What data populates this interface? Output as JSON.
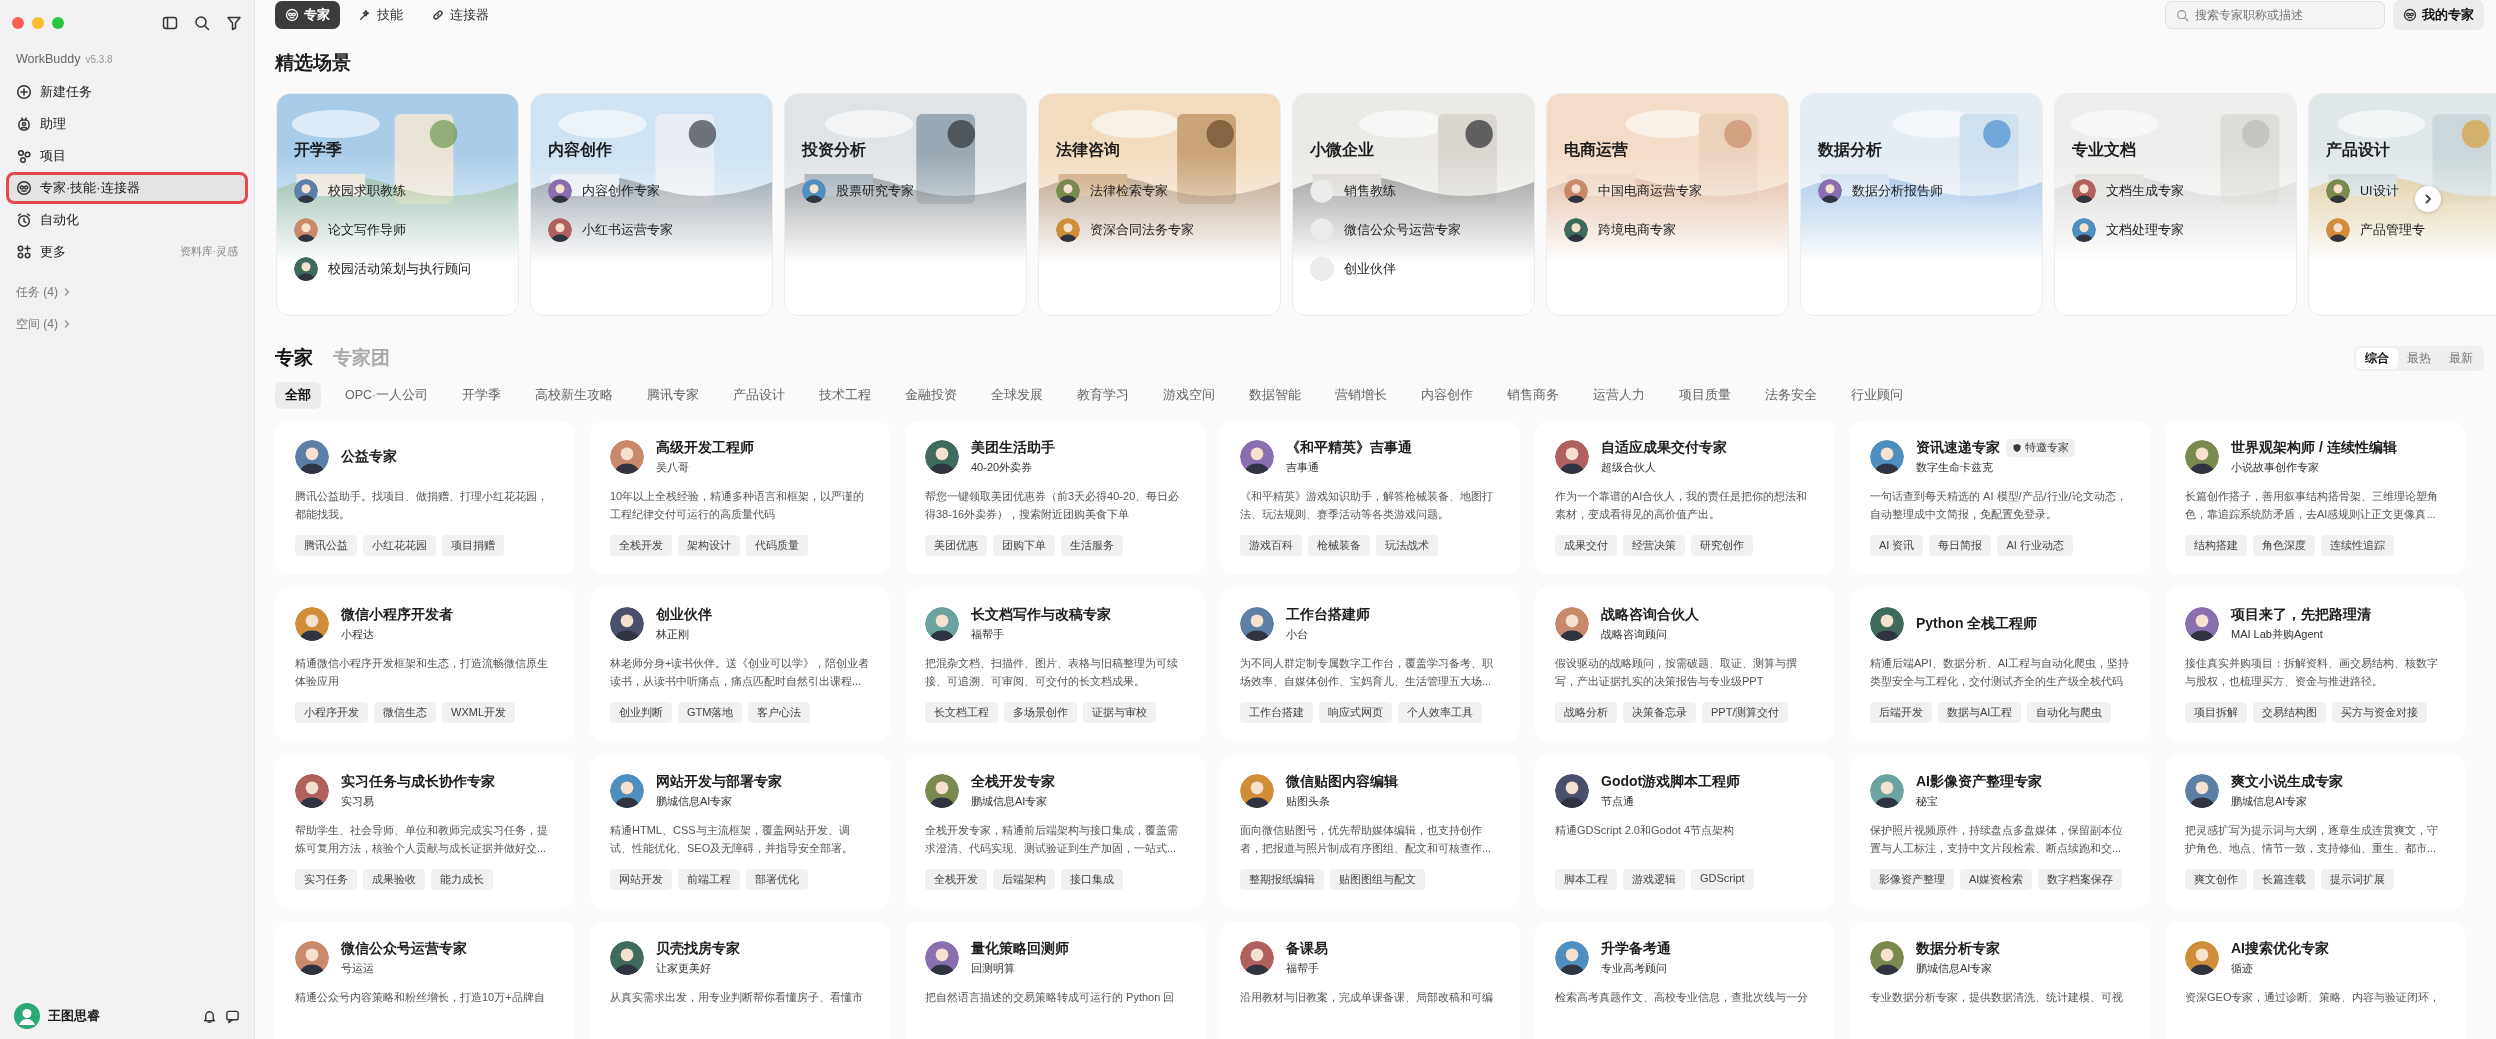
{
  "sidebar": {
    "app_name": "WorkBuddy",
    "version": "v5.3.8",
    "nav": [
      {
        "label": "新建任务",
        "selected": false
      },
      {
        "label": "助理",
        "selected": false
      },
      {
        "label": "项目",
        "selected": false
      },
      {
        "label": "专家·技能·连接器",
        "selected": true
      },
      {
        "label": "自动化",
        "selected": false
      },
      {
        "label": "更多",
        "selected": false,
        "note": "资料库·灵感"
      }
    ],
    "groups": [
      {
        "label": "任务 (4)"
      },
      {
        "label": "空间 (4)"
      }
    ],
    "user": {
      "name": "王图思睿"
    }
  },
  "top_tabs": [
    {
      "label": "专家",
      "selected": true
    },
    {
      "label": "技能",
      "selected": false
    },
    {
      "label": "连接器",
      "selected": false
    }
  ],
  "search": {
    "placeholder": "搜索专家职称或描述"
  },
  "my_experts_button": "我的专家",
  "featured": {
    "title": "精选场景",
    "scenes": [
      {
        "title": "开学季",
        "experts": [
          {
            "name": "校园求职教练",
            "avatar": true
          },
          {
            "name": "论文写作导师",
            "avatar": true
          },
          {
            "name": "校园活动策划与执行顾问",
            "avatar": true
          }
        ]
      },
      {
        "title": "内容创作",
        "experts": [
          {
            "name": "内容创作专家",
            "avatar": true
          },
          {
            "name": "小红书运营专家",
            "avatar": true
          }
        ]
      },
      {
        "title": "投资分析",
        "experts": [
          {
            "name": "股票研究专家",
            "avatar": true
          }
        ]
      },
      {
        "title": "法律咨询",
        "experts": [
          {
            "name": "法律检索专家",
            "avatar": true
          },
          {
            "name": "资深合同法务专家",
            "avatar": true
          }
        ]
      },
      {
        "title": "小微企业",
        "experts": [
          {
            "name": "销售教练",
            "avatar": false
          },
          {
            "name": "微信公众号运营专家",
            "avatar": false
          },
          {
            "name": "创业伙伴",
            "avatar": false
          }
        ]
      },
      {
        "title": "电商运营",
        "experts": [
          {
            "name": "中国电商运营专家",
            "avatar": true
          },
          {
            "name": "跨境电商专家",
            "avatar": true
          }
        ]
      },
      {
        "title": "数据分析",
        "experts": [
          {
            "name": "数据分析报告师",
            "avatar": true
          }
        ]
      },
      {
        "title": "专业文档",
        "experts": [
          {
            "name": "文档生成专家",
            "avatar": true
          },
          {
            "name": "文档处理专家",
            "avatar": true
          }
        ]
      },
      {
        "title": "产品设计",
        "experts": [
          {
            "name": "UI设计",
            "avatar": true
          },
          {
            "name": "产品管理专",
            "avatar": true
          }
        ]
      }
    ]
  },
  "experts": {
    "tabs": [
      {
        "label": "专家",
        "selected": true
      },
      {
        "label": "专家团",
        "selected": false
      }
    ],
    "sort": [
      {
        "label": "综合",
        "selected": true
      },
      {
        "label": "最热",
        "selected": false
      },
      {
        "label": "最新",
        "selected": false
      }
    ],
    "filters": [
      {
        "label": "全部",
        "selected": true
      },
      {
        "label": "OPC·一人公司",
        "selected": false
      },
      {
        "label": "开学季",
        "selected": false
      },
      {
        "label": "高校新生攻略",
        "selected": false
      },
      {
        "label": "腾讯专家",
        "selected": false
      },
      {
        "label": "产品设计",
        "selected": false
      },
      {
        "label": "技术工程",
        "selected": false
      },
      {
        "label": "金融投资",
        "selected": false
      },
      {
        "label": "全球发展",
        "selected": false
      },
      {
        "label": "教育学习",
        "selected": false
      },
      {
        "label": "游戏空间",
        "selected": false
      },
      {
        "label": "数据智能",
        "selected": false
      },
      {
        "label": "营销增长",
        "selected": false
      },
      {
        "label": "内容创作",
        "selected": false
      },
      {
        "label": "销售商务",
        "selected": false
      },
      {
        "label": "运营人力",
        "selected": false
      },
      {
        "label": "项目质量",
        "selected": false
      },
      {
        "label": "法务安全",
        "selected": false
      },
      {
        "label": "行业顾问",
        "selected": false
      }
    ],
    "cards": [
      {
        "title": "公益专家",
        "description": "腾讯公益助手。找项目、做捐赠、打理小红花花园，都能找我。",
        "tags": [
          "腾讯公益",
          "小红花花园",
          "项目捐赠"
        ]
      },
      {
        "title": "高级开发工程师",
        "subtitle": "吴八哥",
        "description": "10年以上全栈经验，精通多种语言和框架，以严谨的工程纪律交付可运行的高质量代码",
        "tags": [
          "全栈开发",
          "架构设计",
          "代码质量"
        ]
      },
      {
        "title": "美团生活助手",
        "subtitle": "40-20外卖券",
        "description": "帮您一键领取美团优惠券（前3天必得40-20、每日必得38-16外卖券），搜索附近团购美食下单",
        "tags": [
          "美团优惠",
          "团购下单",
          "生活服务"
        ]
      },
      {
        "title": "《和平精英》吉事通",
        "subtitle": "吉事通",
        "description": "《和平精英》游戏知识助手，解答枪械装备、地图打法、玩法规则、赛季活动等各类游戏问题。",
        "tags": [
          "游戏百科",
          "枪械装备",
          "玩法战术"
        ]
      },
      {
        "title": "自适应成果交付专家",
        "subtitle": "超级合伙人",
        "description": "作为一个靠谱的AI合伙人，我的责任是把你的想法和素材，变成看得见的高价值产出。",
        "tags": [
          "成果交付",
          "经营决策",
          "研究创作"
        ]
      },
      {
        "title": "资讯速递专家",
        "badge": "特邀专家",
        "subtitle": "数字生命卡兹克",
        "description": "一句话查到每天精选的 AI 模型/产品/行业/论文动态，自动整理成中文简报，免配置免登录。",
        "tags": [
          "AI 资讯",
          "每日简报",
          "AI 行业动态"
        ]
      },
      {
        "title": "世界观架构师 / 连续性编辑",
        "subtitle": "小说故事创作专家",
        "description": "长篇创作搭子，善用叙事结构搭骨架、三维理论塑角色，靠追踪系统防矛盾，去AI感规则让正文更像真...",
        "tags": [
          "结构搭建",
          "角色深度",
          "连续性追踪"
        ]
      },
      {
        "title": "微信小程序开发者",
        "subtitle": "小程达",
        "description": "精通微信小程序开发框架和生态，打造流畅微信原生体验应用",
        "tags": [
          "小程序开发",
          "微信生态",
          "WXML开发"
        ]
      },
      {
        "title": "创业伙伴",
        "subtitle": "林正刚",
        "description": "林老师分身+读书伙伴。送《创业可以学》，陪创业者读书，从读书中听痛点，痛点匹配时自然引出课程...",
        "tags": [
          "创业判断",
          "GTM落地",
          "客户心法"
        ]
      },
      {
        "title": "长文档写作与改稿专家",
        "subtitle": "福帮手",
        "description": "把混杂文档、扫描件、图片、表格与旧稿整理为可续接、可追溯、可审阅、可交付的长文档成果。",
        "tags": [
          "长文档工程",
          "多场景创作",
          "证据与审校"
        ]
      },
      {
        "title": "工作台搭建师",
        "subtitle": "小台",
        "description": "为不同人群定制专属数字工作台，覆盖学习备考、职场效率、自媒体创作、宝妈育儿、生活管理五大场...",
        "tags": [
          "工作台搭建",
          "响应式网页",
          "个人效率工具"
        ]
      },
      {
        "title": "战略咨询合伙人",
        "subtitle": "战略咨询顾问",
        "description": "假设驱动的战略顾问，按需破题、取证、测算与撰写，产出证据扎实的决策报告与专业级PPT",
        "tags": [
          "战略分析",
          "决策备忘录",
          "PPT/测算交付"
        ]
      },
      {
        "title": "Python 全栈工程师",
        "description": "精通后端API、数据分析、AI工程与自动化爬虫，坚持类型安全与工程化，交付测试齐全的生产级全栈代码",
        "tags": [
          "后端开发",
          "数据与AI工程",
          "自动化与爬虫"
        ]
      },
      {
        "title": "项目来了，先把路理清",
        "subtitle": "MAI Lab并购Agent",
        "description": "接住真实并购项目：拆解资料、画交易结构、核数字与股权，也梳理买方、资金与推进路径。",
        "tags": [
          "项目拆解",
          "交易结构图",
          "买方与资金对接"
        ]
      },
      {
        "title": "实习任务与成长协作专家",
        "subtitle": "实习易",
        "description": "帮助学生、社会导师、单位和教师完成实习任务，提炼可复用方法，核验个人贡献与成长证据并做好交...",
        "tags": [
          "实习任务",
          "成果验收",
          "能力成长"
        ]
      },
      {
        "title": "网站开发与部署专家",
        "subtitle": "鹏城信息AI专家",
        "description": "精通HTML、CSS与主流框架，覆盖网站开发、调试、性能优化、SEO及无障碍，并指导安全部署。",
        "tags": [
          "网站开发",
          "前端工程",
          "部署优化"
        ]
      },
      {
        "title": "全栈开发专家",
        "subtitle": "鹏城信息AI专家",
        "description": "全栈开发专家，精通前后端架构与接口集成，覆盖需求澄清、代码实现、测试验证到生产加固，一站式...",
        "tags": [
          "全栈开发",
          "后端架构",
          "接口集成"
        ]
      },
      {
        "title": "微信贴图内容编辑",
        "subtitle": "贴图头条",
        "description": "面向微信贴图号，优先帮助媒体编辑，也支持创作者，把报道与照片制成有序图组、配文和可核查作...",
        "tags": [
          "整期报纸编辑",
          "贴图图组与配文"
        ]
      },
      {
        "title": "Godot游戏脚本工程师",
        "subtitle": "节点通",
        "description": "精通GDScript 2.0和Godot 4节点架构",
        "tags": [
          "脚本工程",
          "游戏逻辑",
          "GDScript"
        ]
      },
      {
        "title": "AI影像资产整理专家",
        "subtitle": "秘宝",
        "description": "保护照片视频原件，持续盘点多盘媒体，保留副本位置与人工标注，支持中文片段检索、断点续跑和交...",
        "tags": [
          "影像资产整理",
          "AI媒资检索",
          "数字档案保存"
        ]
      },
      {
        "title": "爽文小说生成专家",
        "subtitle": "鹏城信息AI专家",
        "description": "把灵感扩写为提示词与大纲，逐章生成连贯爽文，守护角色、地点、情节一致，支持修仙、重生、都市...",
        "tags": [
          "爽文创作",
          "长篇连载",
          "提示词扩展"
        ]
      },
      {
        "title": "微信公众号运营专家",
        "subtitle": "号运运",
        "description": "精通公众号内容策略和粉丝增长，打造10万+品牌自"
      },
      {
        "title": "贝壳找房专家",
        "subtitle": "让家更美好",
        "description": "从真实需求出发，用专业判断帮你看懂房子、看懂市"
      },
      {
        "title": "量化策略回测师",
        "subtitle": "回测明算",
        "description": "把自然语言描述的交易策略转成可运行的 Python 回"
      },
      {
        "title": "备课易",
        "subtitle": "福帮手",
        "description": "沿用教材与旧教案，完成单课备课、局部改稿和可编"
      },
      {
        "title": "升学备考通",
        "subtitle": "专业高考顾问",
        "description": "检索高考真题作文、高校专业信息，查批次线与一分"
      },
      {
        "title": "数据分析专家",
        "subtitle": "鹏城信息AI专家",
        "description": "专业数据分析专家，提供数据清洗、统计建模、可视"
      },
      {
        "title": "AI搜索优化专家",
        "subtitle": "循迹",
        "description": "资深GEO专家，通过诊断、策略、内容与验证闭环，"
      }
    ]
  }
}
